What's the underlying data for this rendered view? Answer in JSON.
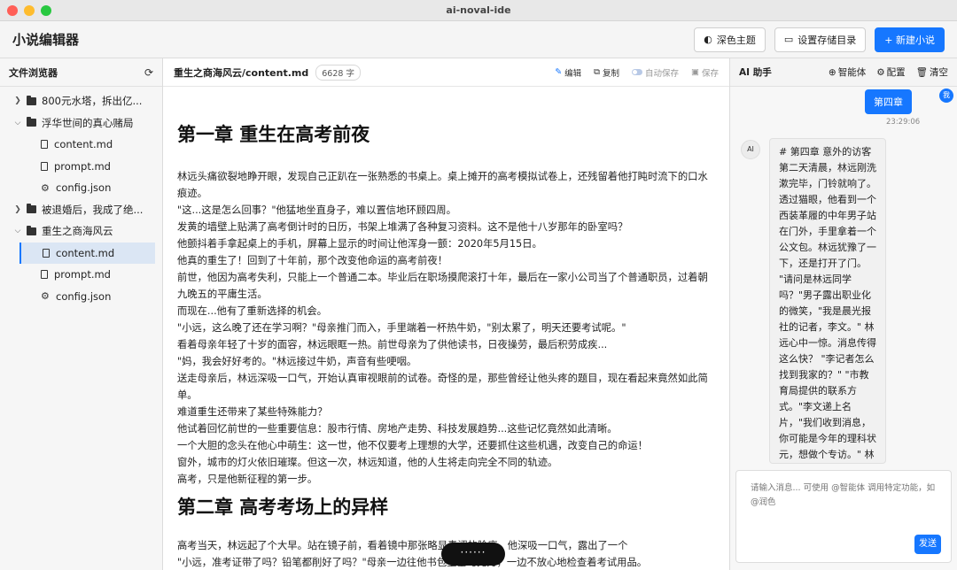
{
  "window": {
    "title": "ai-noval-ide"
  },
  "header": {
    "app_title": "小说编辑器",
    "buttons": {
      "theme": "深色主题",
      "storage": "设置存储目录",
      "new_novel": "+ 新建小说"
    }
  },
  "sidebar": {
    "title": "文件浏览器",
    "tree": [
      {
        "label": "800元水塔，拆出亿..."
      },
      {
        "label": "浮华世间的真心赌局"
      },
      {
        "label": "content.md"
      },
      {
        "label": "prompt.md"
      },
      {
        "label": "config.json"
      },
      {
        "label": "被退婚后，我成了绝..."
      },
      {
        "label": "重生之商海风云"
      },
      {
        "label": "content.md"
      },
      {
        "label": "prompt.md"
      },
      {
        "label": "config.json"
      }
    ]
  },
  "editor": {
    "path": "重生之商海风云/content.md",
    "word_count": "6628 字",
    "actions": {
      "edit": "编辑",
      "copy": "复制",
      "autosave": "自动保存",
      "save": "保存"
    },
    "chapter1_title": "第一章 重生在高考前夜",
    "paragraphs": [
      "林远头痛欲裂地睁开眼，发现自己正趴在一张熟悉的书桌上。桌上摊开的高考模拟试卷上，还残留着他打盹时流下的口水痕迹。",
      "\"这...这是怎么回事？\"他猛地坐直身子，难以置信地环顾四周。",
      "发黄的墙壁上贴满了高考倒计时的日历，书架上堆满了各种复习资料。这不是他十八岁那年的卧室吗？",
      "他颤抖着手拿起桌上的手机，屏幕上显示的时间让他浑身一颤：2020年5月15日。",
      "他真的重生了！回到了十年前，那个改变他命运的高考前夜！",
      "前世，他因为高考失利，只能上一个普通二本。毕业后在职场摸爬滚打十年，最后在一家小公司当了个普通职员，过着朝九晚五的平庸生活。",
      "而现在...他有了重新选择的机会。",
      "\"小远，这么晚了还在学习啊？\"母亲推门而入，手里端着一杯热牛奶，\"别太累了，明天还要考试呢。\"",
      "看着母亲年轻了十岁的面容，林远眼眶一热。前世母亲为了供他读书，日夜操劳，最后积劳成疾...",
      "\"妈，我会好好考的。\"林远接过牛奶，声音有些哽咽。",
      "送走母亲后，林远深吸一口气，开始认真审视眼前的试卷。奇怪的是，那些曾经让他头疼的题目，现在看起来竟然如此简单。",
      "难道重生还带来了某些特殊能力？",
      "他试着回忆前世的一些重要信息：股市行情、房地产走势、科技发展趋势...这些记忆竟然如此清晰。",
      "一个大胆的念头在他心中萌生：这一世，他不仅要考上理想的大学，还要抓住这些机遇，改变自己的命运！",
      "窗外，城市的灯火依旧璀璨。但这一次，林远知道，他的人生将走向完全不同的轨迹。",
      "高考，只是他新征程的第一步。"
    ],
    "chapter2_title": "第二章 高考考场上的异样",
    "paragraphs2": [
      "高考当天，林远起了个大早。站在镜子前，看着镜中那张略显青涩的脸庞，他深吸一口气，露出了一个",
      "\"小远，准考证带了吗？铅笔都削好了吗？\"母亲一边往他书包里塞巧克力，一边不放心地检查着考试用品。"
    ]
  },
  "ai_panel": {
    "title": "AI 助手",
    "actions": {
      "agent": "智能体",
      "config": "配置",
      "clear": "清空"
    },
    "user_message": "第四章",
    "user_avatar": "我",
    "message_time": "23:29:06",
    "ai_avatar": "AI",
    "ai_message": "# 第四章 意外的访客 第二天清晨，林远刚洗漱完毕，门铃就响了。 透过猫眼，他看到一个西装革履的中年男子站在门外，手里拿着一个公文包。林远犹豫了一下，还是打开了门。 \"请问是林远同学吗？\"男子露出职业化的微笑，\"我是晨光报社的记者，李文。\" 林远心中一惊。消息传得这么快？ \"李记者怎么找到我家的？\" \"市教育局提供的联系方式。\"李文递上名片，\"我们收到消息，你可能是今年的理科状元，想做个专访。\" 林远接过名片，眉头微皱：\"王老师说消息还要保密。\" \"放心，报道会在成绩公布出正式",
    "input_placeholder": "请输入消息... 可使用 @智能体 调用特定功能，如 @润色",
    "send_label": "发送"
  },
  "bottom_pill": "······"
}
